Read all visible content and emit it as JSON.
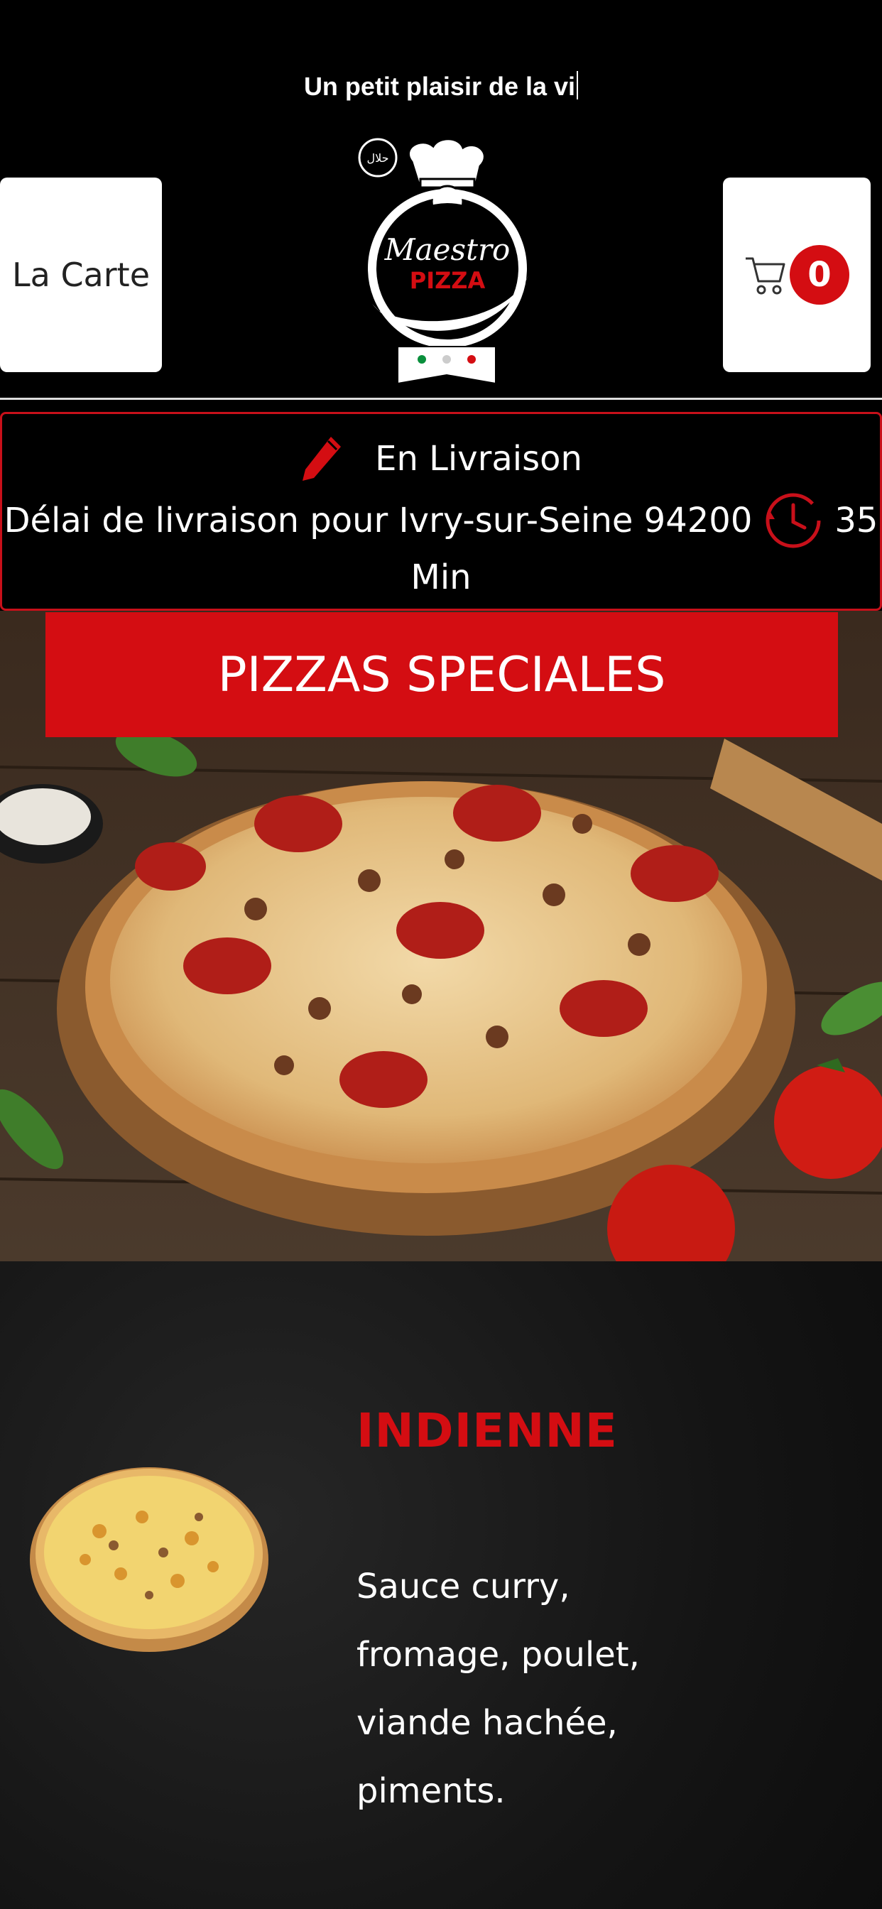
{
  "header": {
    "tagline": "Un petit plaisir de la vi",
    "menu_button_label": "La Carte",
    "cart_count": "0",
    "logo_text_top": "Maestro",
    "logo_text_bottom": "PIZZA",
    "halal_badge": "حلال"
  },
  "delivery": {
    "mode_label": "En Livraison",
    "delay_label": "Délai de livraison pour Ivry-sur-Seine 94200",
    "delay_value": "35",
    "delay_unit": "Min"
  },
  "category": {
    "title": "PIZZAS SPECIALES"
  },
  "item": {
    "name": "INDIENNE",
    "description": "Sauce curry, fromage, poulet, viande hachée, piments."
  },
  "colors": {
    "brand_red": "#d40d12",
    "background": "#000000"
  },
  "icons": [
    "pencil-icon",
    "clock-icon",
    "cart-icon",
    "halal-icon"
  ]
}
